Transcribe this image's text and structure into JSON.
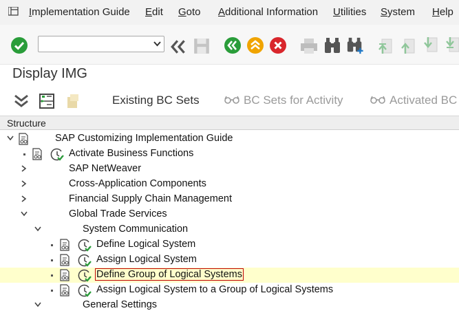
{
  "menu": {
    "items": [
      "Implementation Guide",
      "Edit",
      "Goto",
      "Additional Information",
      "Utilities",
      "System",
      "Help"
    ]
  },
  "toolbar": {
    "command_field_value": "",
    "icons": [
      "checkmark-icon",
      "double-chevron-left-icon",
      "save-icon",
      "back-icon",
      "exit-icon",
      "cancel-icon",
      "print-icon",
      "find-icon",
      "find-next-icon",
      "first-page-icon",
      "previous-page-icon",
      "next-page-icon",
      "last-page-icon"
    ]
  },
  "title": "Display IMG",
  "app_toolbar": {
    "existing_bc_sets": "Existing BC Sets",
    "bc_sets_for_activity": "BC Sets for Activity",
    "activated_bc_sets": "Activated BC"
  },
  "structure_header": "Structure",
  "tree": [
    {
      "label": "SAP Customizing Implementation Guide",
      "state": "expanded"
    },
    {
      "label": "Activate Business Functions",
      "state": "leaf"
    },
    {
      "label": "SAP NetWeaver",
      "state": "collapsed"
    },
    {
      "label": "Cross-Application Components",
      "state": "collapsed"
    },
    {
      "label": "Financial Supply Chain Management",
      "state": "collapsed"
    },
    {
      "label": "Global Trade Services",
      "state": "expanded"
    },
    {
      "label": "System Communication",
      "state": "expanded"
    },
    {
      "label": "Define Logical System",
      "state": "leaf"
    },
    {
      "label": "Assign Logical System",
      "state": "leaf"
    },
    {
      "label": "Define Group of Logical Systems",
      "state": "leaf",
      "selected": true
    },
    {
      "label": "Assign Logical System to a Group of Logical Systems",
      "state": "leaf"
    },
    {
      "label": "General Settings",
      "state": "expanded"
    }
  ],
  "colors": {
    "selected_row": "#ffffcc",
    "focus_outline": "#c00000",
    "execute_green": "#2a9d3a",
    "exit_orange": "#f0a400",
    "cancel_red": "#d9262c"
  }
}
